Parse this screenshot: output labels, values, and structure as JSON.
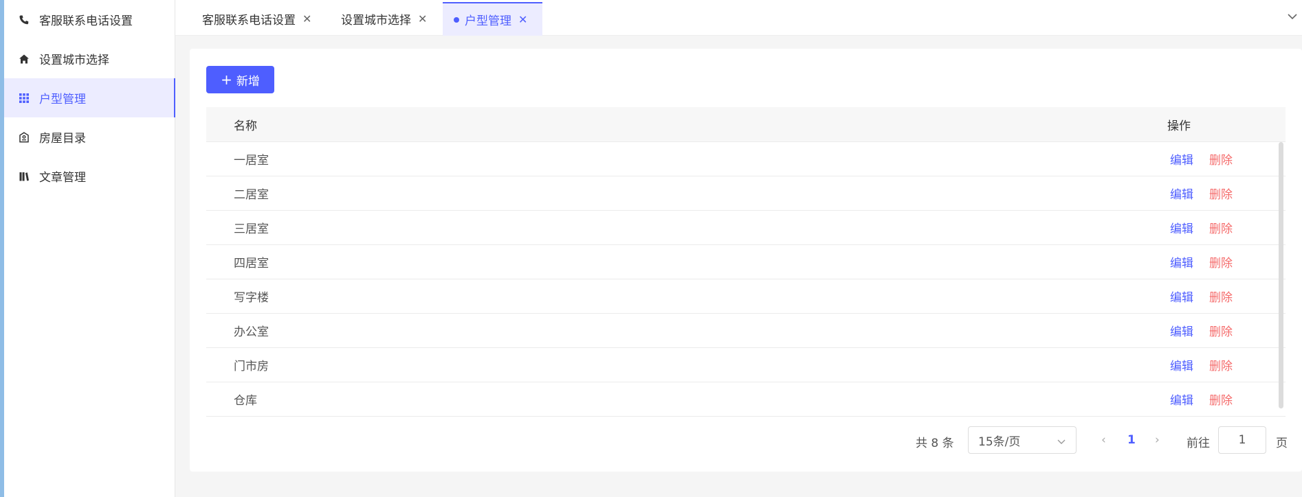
{
  "sidebar": {
    "items": [
      {
        "label": "客服联系电话设置",
        "icon": "phone-icon",
        "active": false
      },
      {
        "label": "设置城市选择",
        "icon": "home-icon",
        "active": false
      },
      {
        "label": "户型管理",
        "icon": "grid-icon",
        "active": true
      },
      {
        "label": "房屋目录",
        "icon": "house-tag-icon",
        "active": false
      },
      {
        "label": "文章管理",
        "icon": "books-icon",
        "active": false
      }
    ]
  },
  "tabs": [
    {
      "label": "客服联系电话设置",
      "active": false
    },
    {
      "label": "设置城市选择",
      "active": false
    },
    {
      "label": "户型管理",
      "active": true
    }
  ],
  "toolbar": {
    "add_label": "新增"
  },
  "table": {
    "columns": {
      "name": "名称",
      "ops": "操作"
    },
    "edit_label": "编辑",
    "delete_label": "删除",
    "rows": [
      "一居室",
      "二居室",
      "三居室",
      "四居室",
      "写字楼",
      "办公室",
      "门市房",
      "仓库"
    ]
  },
  "pager": {
    "total_text": "共 8 条",
    "page_size": "15条/页",
    "current_page": "1",
    "goto_label": "前往",
    "goto_value": "1",
    "page_unit": "页"
  },
  "colors": {
    "accent": "#4e5eff",
    "danger": "#f56c6c"
  }
}
